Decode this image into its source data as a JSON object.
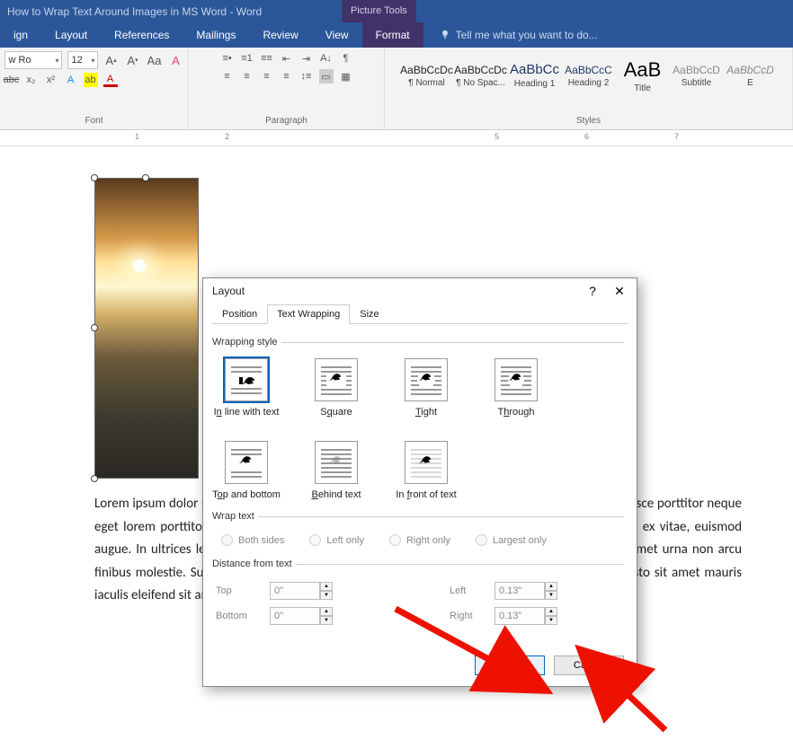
{
  "title": "How to Wrap Text Around Images in MS Word - Word",
  "picture_tools": "Picture Tools",
  "tabs": {
    "design": "ign",
    "layout": "Layout",
    "references": "References",
    "mailings": "Mailings",
    "review": "Review",
    "view": "View",
    "format": "Format"
  },
  "tell_me": "Tell me what you want to do...",
  "ribbon": {
    "font_name": "w Ro",
    "font_size": "12",
    "font_label": "Font",
    "paragraph_label": "Paragraph",
    "styles_label": "Styles",
    "styles": [
      {
        "sample": "AaBbCcDc",
        "name": "¶ Normal"
      },
      {
        "sample": "AaBbCcDc",
        "name": "¶ No Spac..."
      },
      {
        "sample": "AaBbCc",
        "name": "Heading 1"
      },
      {
        "sample": "AaBbCcC",
        "name": "Heading 2"
      },
      {
        "sample": "AaB",
        "name": "Title"
      },
      {
        "sample": "AaBbCcD",
        "name": "Subtitle"
      },
      {
        "sample": "AaBbCcD",
        "name": "E"
      }
    ]
  },
  "ruler_numbers": [
    "1",
    "2",
    "5",
    "6",
    "7"
  ],
  "body_text": "Lorem ipsum dolor sit amet, consectetur adipiscing elit. Aenean rutrum urna at bibendum odio. Fusce porttitor neque eget lorem porttitor, a bibendum lectus pulvinar. Fusce ac enim. Morbi ut odio finibus, volutpat ex vitae, euismod augue. In ultrices lectus ex, eu bibendum neque cursus eu. Nunc sed auctor turpis. Integer sit amet urna non arcu finibus molestie. Suspendisse blandit felis a leo pellentesque, non rhoncus sapien porta. In at justo sit amet mauris iaculis eleifend sit amet ac elit. Maecenas vel dolor pharetra elit elementum eleifend.",
  "dialog": {
    "title": "Layout",
    "tabs": {
      "position": "Position",
      "text_wrapping": "Text Wrapping",
      "size": "Size"
    },
    "wrapping_style_label": "Wrapping style",
    "options": {
      "inline": "In line with text",
      "square": "Square",
      "tight": "Tight",
      "through": "Through",
      "top_bottom": "Top and bottom",
      "behind": "Behind text",
      "front": "In front of text"
    },
    "wrap_text_label": "Wrap text",
    "wrap_text_options": {
      "both": "Both sides",
      "left": "Left only",
      "right": "Right only",
      "largest": "Largest only"
    },
    "distance_label": "Distance from text",
    "distance": {
      "top_label": "Top",
      "top": "0\"",
      "bottom_label": "Bottom",
      "bottom": "0\"",
      "left_label": "Left",
      "left": "0.13\"",
      "right_label": "Right",
      "right": "0.13\""
    },
    "ok": "OK",
    "cancel": "Cancel"
  }
}
